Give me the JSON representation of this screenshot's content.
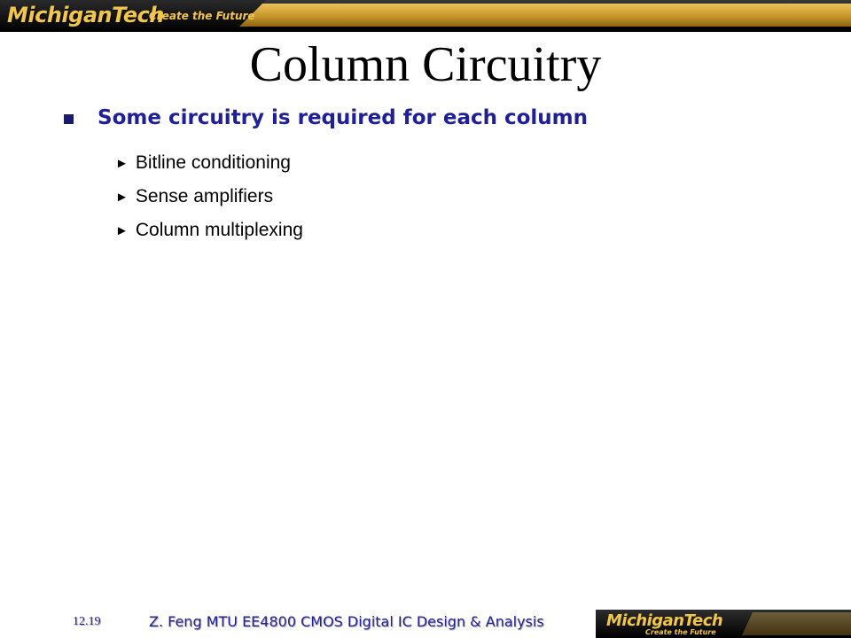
{
  "header": {
    "logo_text": "MichiganTech",
    "tagline": "Create the Future"
  },
  "slide": {
    "title": "Column Circuitry",
    "main_bullet": "Some circuitry is required for each column",
    "sub_bullets": [
      "Bitline conditioning",
      "Sense amplifiers",
      "Column multiplexing"
    ],
    "sub_bullet_marker": "►"
  },
  "footer": {
    "slide_number": "12.19",
    "text": "Z. Feng  MTU EE4800 CMOS Digital IC Design & Analysis",
    "logo_text": "MichiganTech",
    "logo_tagline": "Create the Future"
  },
  "colors": {
    "title": "#000000",
    "main_bullet": "#1f1f99",
    "footer": "#1f1f99",
    "logo_gold": "#f2c54b"
  }
}
